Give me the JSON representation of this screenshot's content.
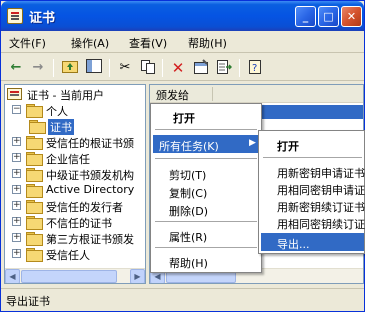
{
  "window": {
    "title": "证书"
  },
  "titlebar": {
    "min": "_",
    "max": "□",
    "close": "✕"
  },
  "menubar": {
    "items": [
      "文件(F)",
      "操作(A)",
      "查看(V)",
      "帮助(H)"
    ]
  },
  "toolbar": {
    "icons": [
      "back-arrow-icon",
      "forward-arrow-icon",
      "up-folder-icon",
      "show-tree-icon",
      "cut-icon",
      "copy-icon",
      "delete-icon",
      "properties-icon",
      "export-list-icon",
      "help-icon"
    ]
  },
  "tree": {
    "root": "证书 - 当前用户",
    "items": [
      {
        "label": "个人",
        "expanded": true
      },
      {
        "label": "证书",
        "selected": true
      },
      {
        "label": "受信任的根证书颁"
      },
      {
        "label": "企业信任"
      },
      {
        "label": "中级证书颁发机构"
      },
      {
        "label": "Active Directory"
      },
      {
        "label": "受信任的发行者"
      },
      {
        "label": "不信任的证书"
      },
      {
        "label": "第三方根证书颁发"
      },
      {
        "label": "受信任人"
      }
    ]
  },
  "list": {
    "column_header": "颁发给"
  },
  "context_menu": {
    "items": [
      "打开",
      "所有任务(K)",
      "剪切(T)",
      "复制(C)",
      "删除(D)",
      "属性(R)",
      "帮助(H)"
    ],
    "submenu_arrow": "▶"
  },
  "submenu": {
    "items": [
      "打开",
      "用新密钥申请证书",
      "用相同密钥申请证",
      "用新密钥续订证书",
      "用相同密钥续订证",
      "导出..."
    ]
  },
  "statusbar": {
    "text": "导出证书"
  },
  "colors": {
    "highlight": "#316ac5",
    "titlebar": "#0554e3",
    "face": "#ece9d8"
  }
}
